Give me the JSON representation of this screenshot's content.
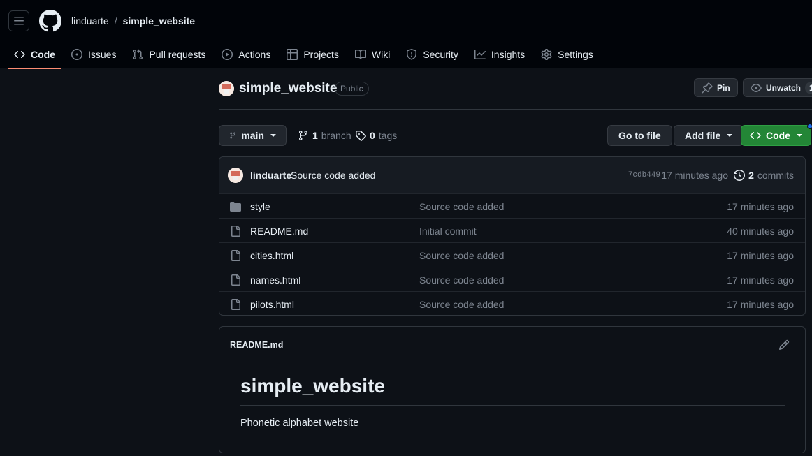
{
  "header": {
    "owner": "linduarte",
    "separator": "/",
    "repo": "simple_website"
  },
  "tabs": [
    {
      "label": "Code",
      "icon": "code-icon"
    },
    {
      "label": "Issues",
      "icon": "issue-icon"
    },
    {
      "label": "Pull requests",
      "icon": "pull-request-icon"
    },
    {
      "label": "Actions",
      "icon": "play-icon"
    },
    {
      "label": "Projects",
      "icon": "table-icon"
    },
    {
      "label": "Wiki",
      "icon": "book-icon"
    },
    {
      "label": "Security",
      "icon": "shield-icon"
    },
    {
      "label": "Insights",
      "icon": "graph-icon"
    },
    {
      "label": "Settings",
      "icon": "gear-icon"
    }
  ],
  "repo": {
    "name": "simple_website",
    "visibility": "Public",
    "pin_label": "Pin",
    "unwatch_label": "Unwatch",
    "watch_count": "1"
  },
  "toolbar": {
    "branch": "main",
    "branch_count": "1",
    "branch_word": "branch",
    "tag_count": "0",
    "tag_word": "tags",
    "go_to_file": "Go to file",
    "add_file": "Add file",
    "code": "Code"
  },
  "latest_commit": {
    "author": "linduarte",
    "message": "Source code added",
    "sha": "7cdb449",
    "time": "17 minutes ago",
    "count": "2",
    "count_word": "commits"
  },
  "files": [
    {
      "name": "style",
      "type": "folder",
      "message": "Source code added",
      "time": "17 minutes ago"
    },
    {
      "name": "README.md",
      "type": "file",
      "message": "Initial commit",
      "time": "40 minutes ago"
    },
    {
      "name": "cities.html",
      "type": "file",
      "message": "Source code added",
      "time": "17 minutes ago"
    },
    {
      "name": "names.html",
      "type": "file",
      "message": "Source code added",
      "time": "17 minutes ago"
    },
    {
      "name": "pilots.html",
      "type": "file",
      "message": "Source code added",
      "time": "17 minutes ago"
    }
  ],
  "readme": {
    "filename": "README.md",
    "heading": "simple_website",
    "body": "Phonetic alphabet website"
  },
  "colors": {
    "accent_underline": "#fd8c73",
    "primary_green": "#238636",
    "folder_blue": "#7d8590"
  }
}
